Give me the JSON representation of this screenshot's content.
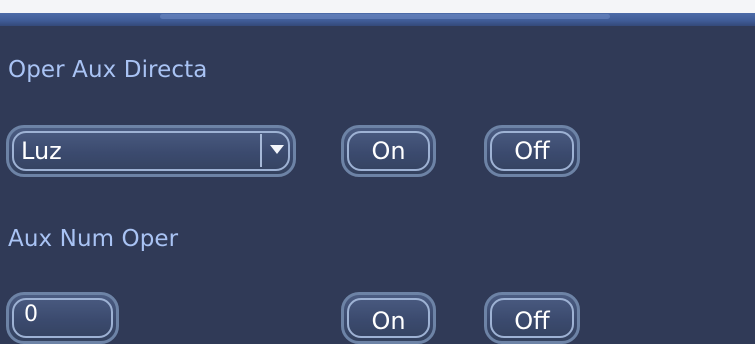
{
  "section_direct": {
    "label": "Oper Aux Directa",
    "dropdown_value": "Luz",
    "on_label": "On",
    "off_label": "Off"
  },
  "section_num": {
    "label": "Aux Num Oper",
    "number_value": "0",
    "on_label": "On",
    "off_label": "Off"
  },
  "colors": {
    "background": "#303a57",
    "label_text": "#a9c3f4",
    "button_border": "#6d83a6",
    "top_bar": "#4d6ba8"
  },
  "icons": {
    "dropdown_arrow": "chevron-down-icon"
  }
}
